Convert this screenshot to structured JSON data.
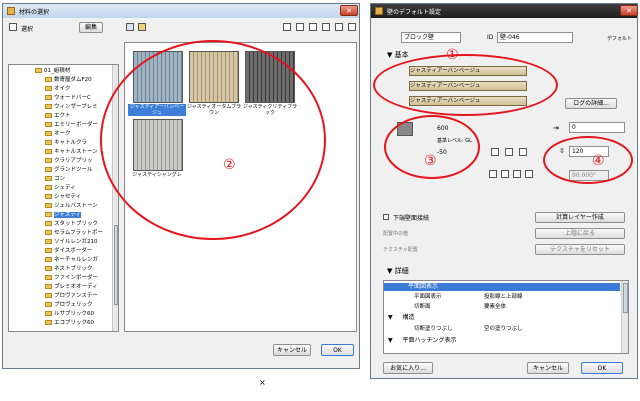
{
  "left_window": {
    "title": "材料の選択",
    "toolbar": {
      "select_label": "選択",
      "edit_button": "編集"
    },
    "tree": {
      "root": "01_組積材",
      "items": [
        "数寄屋ダムF20",
        "オイク",
        "ウォードバーC",
        "ウィンザープレミ",
        "エクト",
        "エミリーボーダー",
        "オーク",
        "キャトルクラ",
        "キャトルストーン",
        "クラリアブリッ",
        "グランドツール",
        "コン",
        "シェディ",
        "シャセティ",
        "ジェルバストーン",
        "ジャスティ",
        "スタットブリック",
        "セラムフラットボー",
        "ソイルレンガ210",
        "ダイスボーダー",
        "ネーチャルレンガ",
        "ネストブリック",
        "ファインボーダー",
        "プレミオオーディ",
        "プロヴァンステー",
        "プロヴェリック",
        "ルサブリック60",
        "エコブリック60"
      ],
      "selected_index": 15
    },
    "materials": [
      {
        "label": "ジャスティアーバンベージュ",
        "selected": true
      },
      {
        "label": "ジャスティオータムブラウン",
        "selected": false
      },
      {
        "label": "ジャスティクリティブラック",
        "selected": false
      },
      {
        "label": "ジャスティシャングレ",
        "selected": false
      }
    ],
    "cancel_button": "キャンセル",
    "ok_button": "OK"
  },
  "right_window": {
    "title": "壁のデフォルト設定",
    "layer_label": "ブロック壁",
    "id_label": "ID",
    "id_value": "壁-046",
    "default_label": "デフォルト",
    "basic_section": "基本",
    "layers": [
      "ジャスティアーバンベージュ",
      "ジャスティアーバンベージュ",
      "ジャスティアーバンベージュ"
    ],
    "log_details_button": "ログの詳細...",
    "height_top": "600",
    "ref_level": "基準レベル: GL",
    "height_bottom": "-50",
    "offset_value": "0",
    "thickness_value": "120",
    "angle_value": "90.000°",
    "option_checkbox": "下端壁面接続",
    "floor_section_label": "配置中の階",
    "floor_value": "上階に戻る",
    "texture_label": "テクスチャ配置",
    "texture_value": "テクスチャをリセット",
    "calc_button": "計算レイヤー作成",
    "detail_section": "詳細",
    "plan_display_row": "平面図表示",
    "plan_rows": [
      {
        "name": "平面図表示",
        "value": "投影線と上部線"
      },
      {
        "name": "切断面",
        "value": "要素全体"
      }
    ],
    "structure_row": "構造",
    "structure_rows": [
      {
        "name": "切断塗りつぶし",
        "value": "空の塗りつぶし"
      }
    ],
    "plan_hatch_row": "平面ハッチング表示",
    "favorites_button": "お気に入り...",
    "cancel_button": "キャンセル",
    "ok_button": "OK"
  },
  "annotations": {
    "circle_1": "①",
    "circle_2": "②",
    "circle_3": "③",
    "circle_4": "④",
    "annotation_color": "#e3161d"
  },
  "extra_mark": "×"
}
